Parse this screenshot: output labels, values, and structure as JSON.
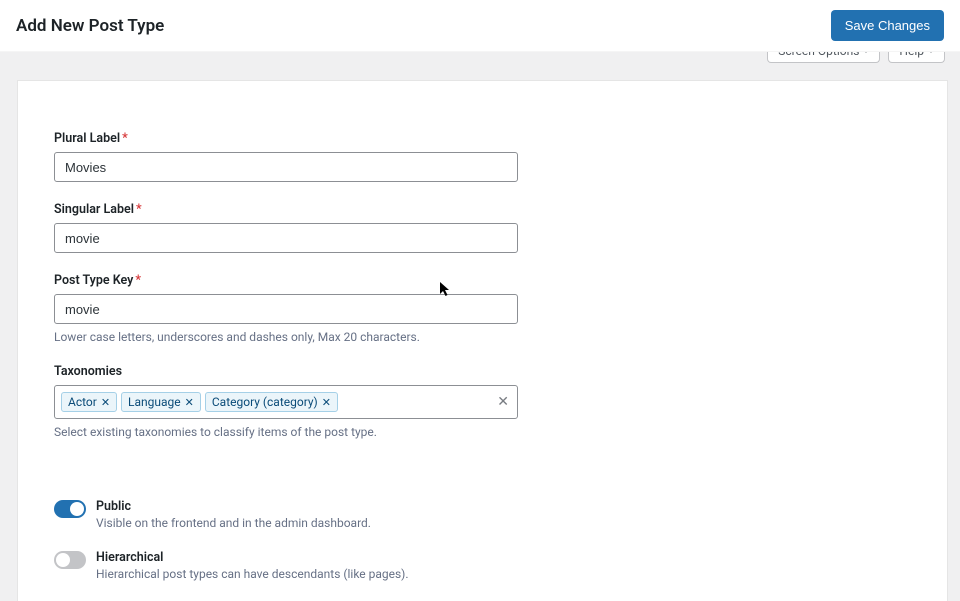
{
  "header": {
    "title": "Add New Post Type",
    "save_label": "Save Changes"
  },
  "top_tabs": {
    "screen_options": "Screen Options",
    "help": "Help"
  },
  "fields": {
    "plural": {
      "label": "Plural Label",
      "value": "Movies"
    },
    "singular": {
      "label": "Singular Label",
      "value": "movie"
    },
    "key": {
      "label": "Post Type Key",
      "value": "movie",
      "help": "Lower case letters, underscores and dashes only, Max 20 characters."
    },
    "taxonomies": {
      "label": "Taxonomies",
      "help": "Select existing taxonomies to classify items of the post type.",
      "tags": [
        "Actor",
        "Language",
        "Category (category)"
      ]
    }
  },
  "toggles": {
    "public": {
      "title": "Public",
      "desc": "Visible on the frontend and in the admin dashboard.",
      "on": true
    },
    "hierarchical": {
      "title": "Hierarchical",
      "desc": "Hierarchical post types can have descendants (like pages).",
      "on": false
    }
  }
}
